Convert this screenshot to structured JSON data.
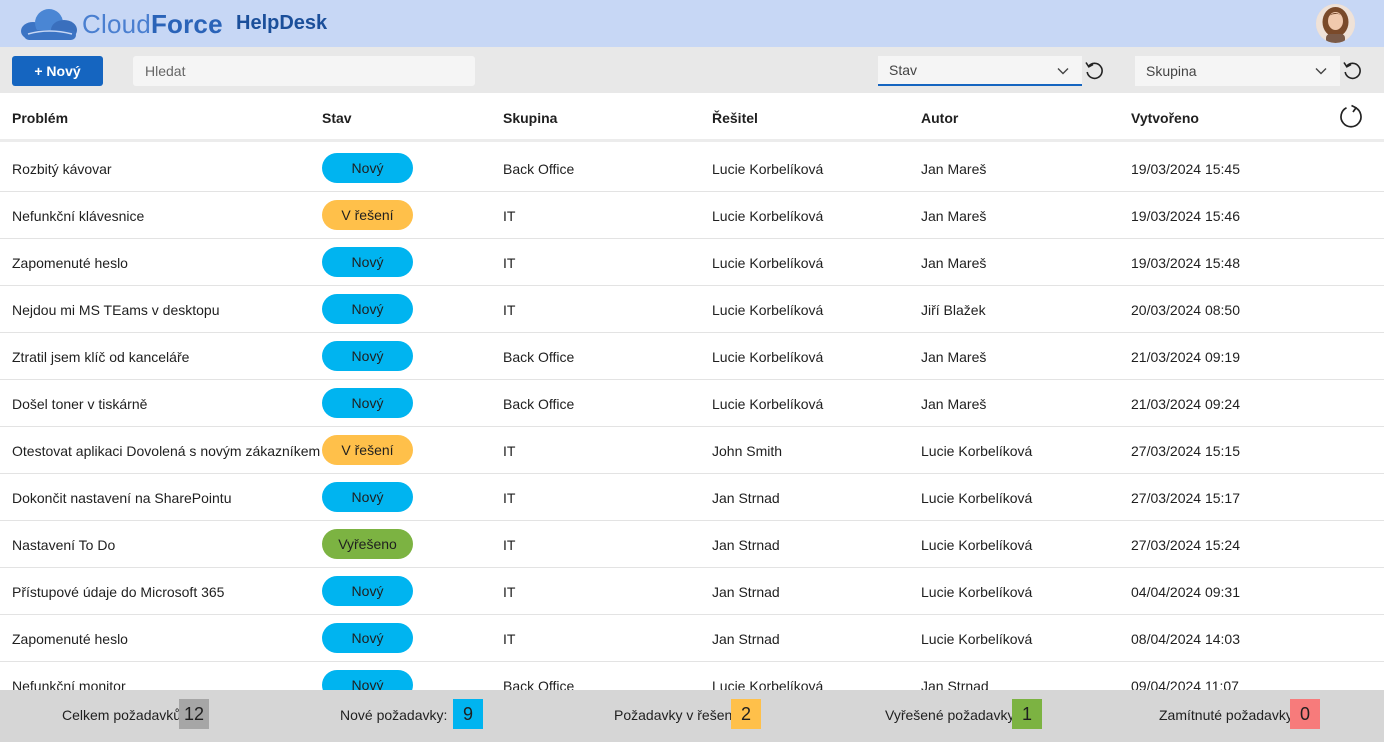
{
  "header": {
    "logo_text_light": "Cloud",
    "logo_text_bold": "Force",
    "app_name": "HelpDesk"
  },
  "toolbar": {
    "new_label": "+ Nový",
    "search_placeholder": "Hledat",
    "filter_stav": "Stav",
    "filter_skupina": "Skupina"
  },
  "table": {
    "columns": [
      "Problém",
      "Stav",
      "Skupina",
      "Řešitel",
      "Autor",
      "Vytvořeno"
    ],
    "rows": [
      {
        "problem": "Rozbitý kávovar",
        "status": "Nový",
        "status_key": "novy",
        "group": "Back Office",
        "solver": "Lucie Korbelíková",
        "author": "Jan Mareš",
        "created": "19/03/2024 15:45"
      },
      {
        "problem": "Nefunkční klávesnice",
        "status": "V řešení",
        "status_key": "reseni",
        "group": "IT",
        "solver": "Lucie Korbelíková",
        "author": "Jan Mareš",
        "created": "19/03/2024 15:46"
      },
      {
        "problem": "Zapomenuté heslo",
        "status": "Nový",
        "status_key": "novy",
        "group": "IT",
        "solver": "Lucie Korbelíková",
        "author": "Jan Mareš",
        "created": "19/03/2024 15:48"
      },
      {
        "problem": "Nejdou mi MS TEams v desktopu",
        "status": "Nový",
        "status_key": "novy",
        "group": "IT",
        "solver": "Lucie Korbelíková",
        "author": "Jiří Blažek",
        "created": "20/03/2024 08:50"
      },
      {
        "problem": "Ztratil jsem klíč od kanceláře",
        "status": "Nový",
        "status_key": "novy",
        "group": "Back Office",
        "solver": "Lucie Korbelíková",
        "author": "Jan Mareš",
        "created": "21/03/2024 09:19"
      },
      {
        "problem": "Došel toner v tiskárně",
        "status": "Nový",
        "status_key": "novy",
        "group": "Back Office",
        "solver": "Lucie Korbelíková",
        "author": "Jan Mareš",
        "created": "21/03/2024 09:24"
      },
      {
        "problem": "Otestovat aplikaci Dovolená s novým zákazníkem",
        "status": "V řešení",
        "status_key": "reseni",
        "group": "IT",
        "solver": "John Smith",
        "author": "Lucie Korbelíková",
        "created": "27/03/2024 15:15"
      },
      {
        "problem": "Dokončit nastavení na SharePointu",
        "status": "Nový",
        "status_key": "novy",
        "group": "IT",
        "solver": "Jan Strnad",
        "author": "Lucie Korbelíková",
        "created": "27/03/2024 15:17"
      },
      {
        "problem": "Nastavení To Do",
        "status": "Vyřešeno",
        "status_key": "vyreseno",
        "group": "IT",
        "solver": "Jan Strnad",
        "author": "Lucie Korbelíková",
        "created": "27/03/2024 15:24"
      },
      {
        "problem": "Přístupové údaje do Microsoft 365",
        "status": "Nový",
        "status_key": "novy",
        "group": "IT",
        "solver": "Jan Strnad",
        "author": "Lucie Korbelíková",
        "created": "04/04/2024 09:31"
      },
      {
        "problem": "Zapomenuté heslo",
        "status": "Nový",
        "status_key": "novy",
        "group": "IT",
        "solver": "Jan Strnad",
        "author": "Lucie Korbelíková",
        "created": "08/04/2024 14:03"
      },
      {
        "problem": "Nefunkční monitor",
        "status": "Nový",
        "status_key": "novy",
        "group": "Back Office",
        "solver": "Lucie Korbelíková",
        "author": "Jan Strnad",
        "created": "09/04/2024 11:07"
      }
    ]
  },
  "footer": {
    "total_label": "Celkem požadavků:",
    "total_value": "12",
    "new_label": "Nové požadavky:",
    "new_value": "9",
    "in_progress_label": "Požadavky v řešení:",
    "in_progress_value": "2",
    "resolved_label": "Vyřešené požadavky:",
    "resolved_value": "1",
    "rejected_label": "Zamítnuté požadavky:",
    "rejected_value": "0"
  },
  "colors": {
    "header_bg": "#c7d7f5",
    "primary": "#1565c0",
    "status_new": "#00b4f0",
    "status_in_progress": "#ffc04a",
    "status_resolved": "#7cb342",
    "total_box": "#a6a6a6",
    "rejected_box": "#f77b7b"
  },
  "icons": {
    "logo": "cloud-logo",
    "filter_reset": "undo-icon",
    "refresh": "refresh-icon",
    "dropdown": "chevron-down-icon"
  }
}
